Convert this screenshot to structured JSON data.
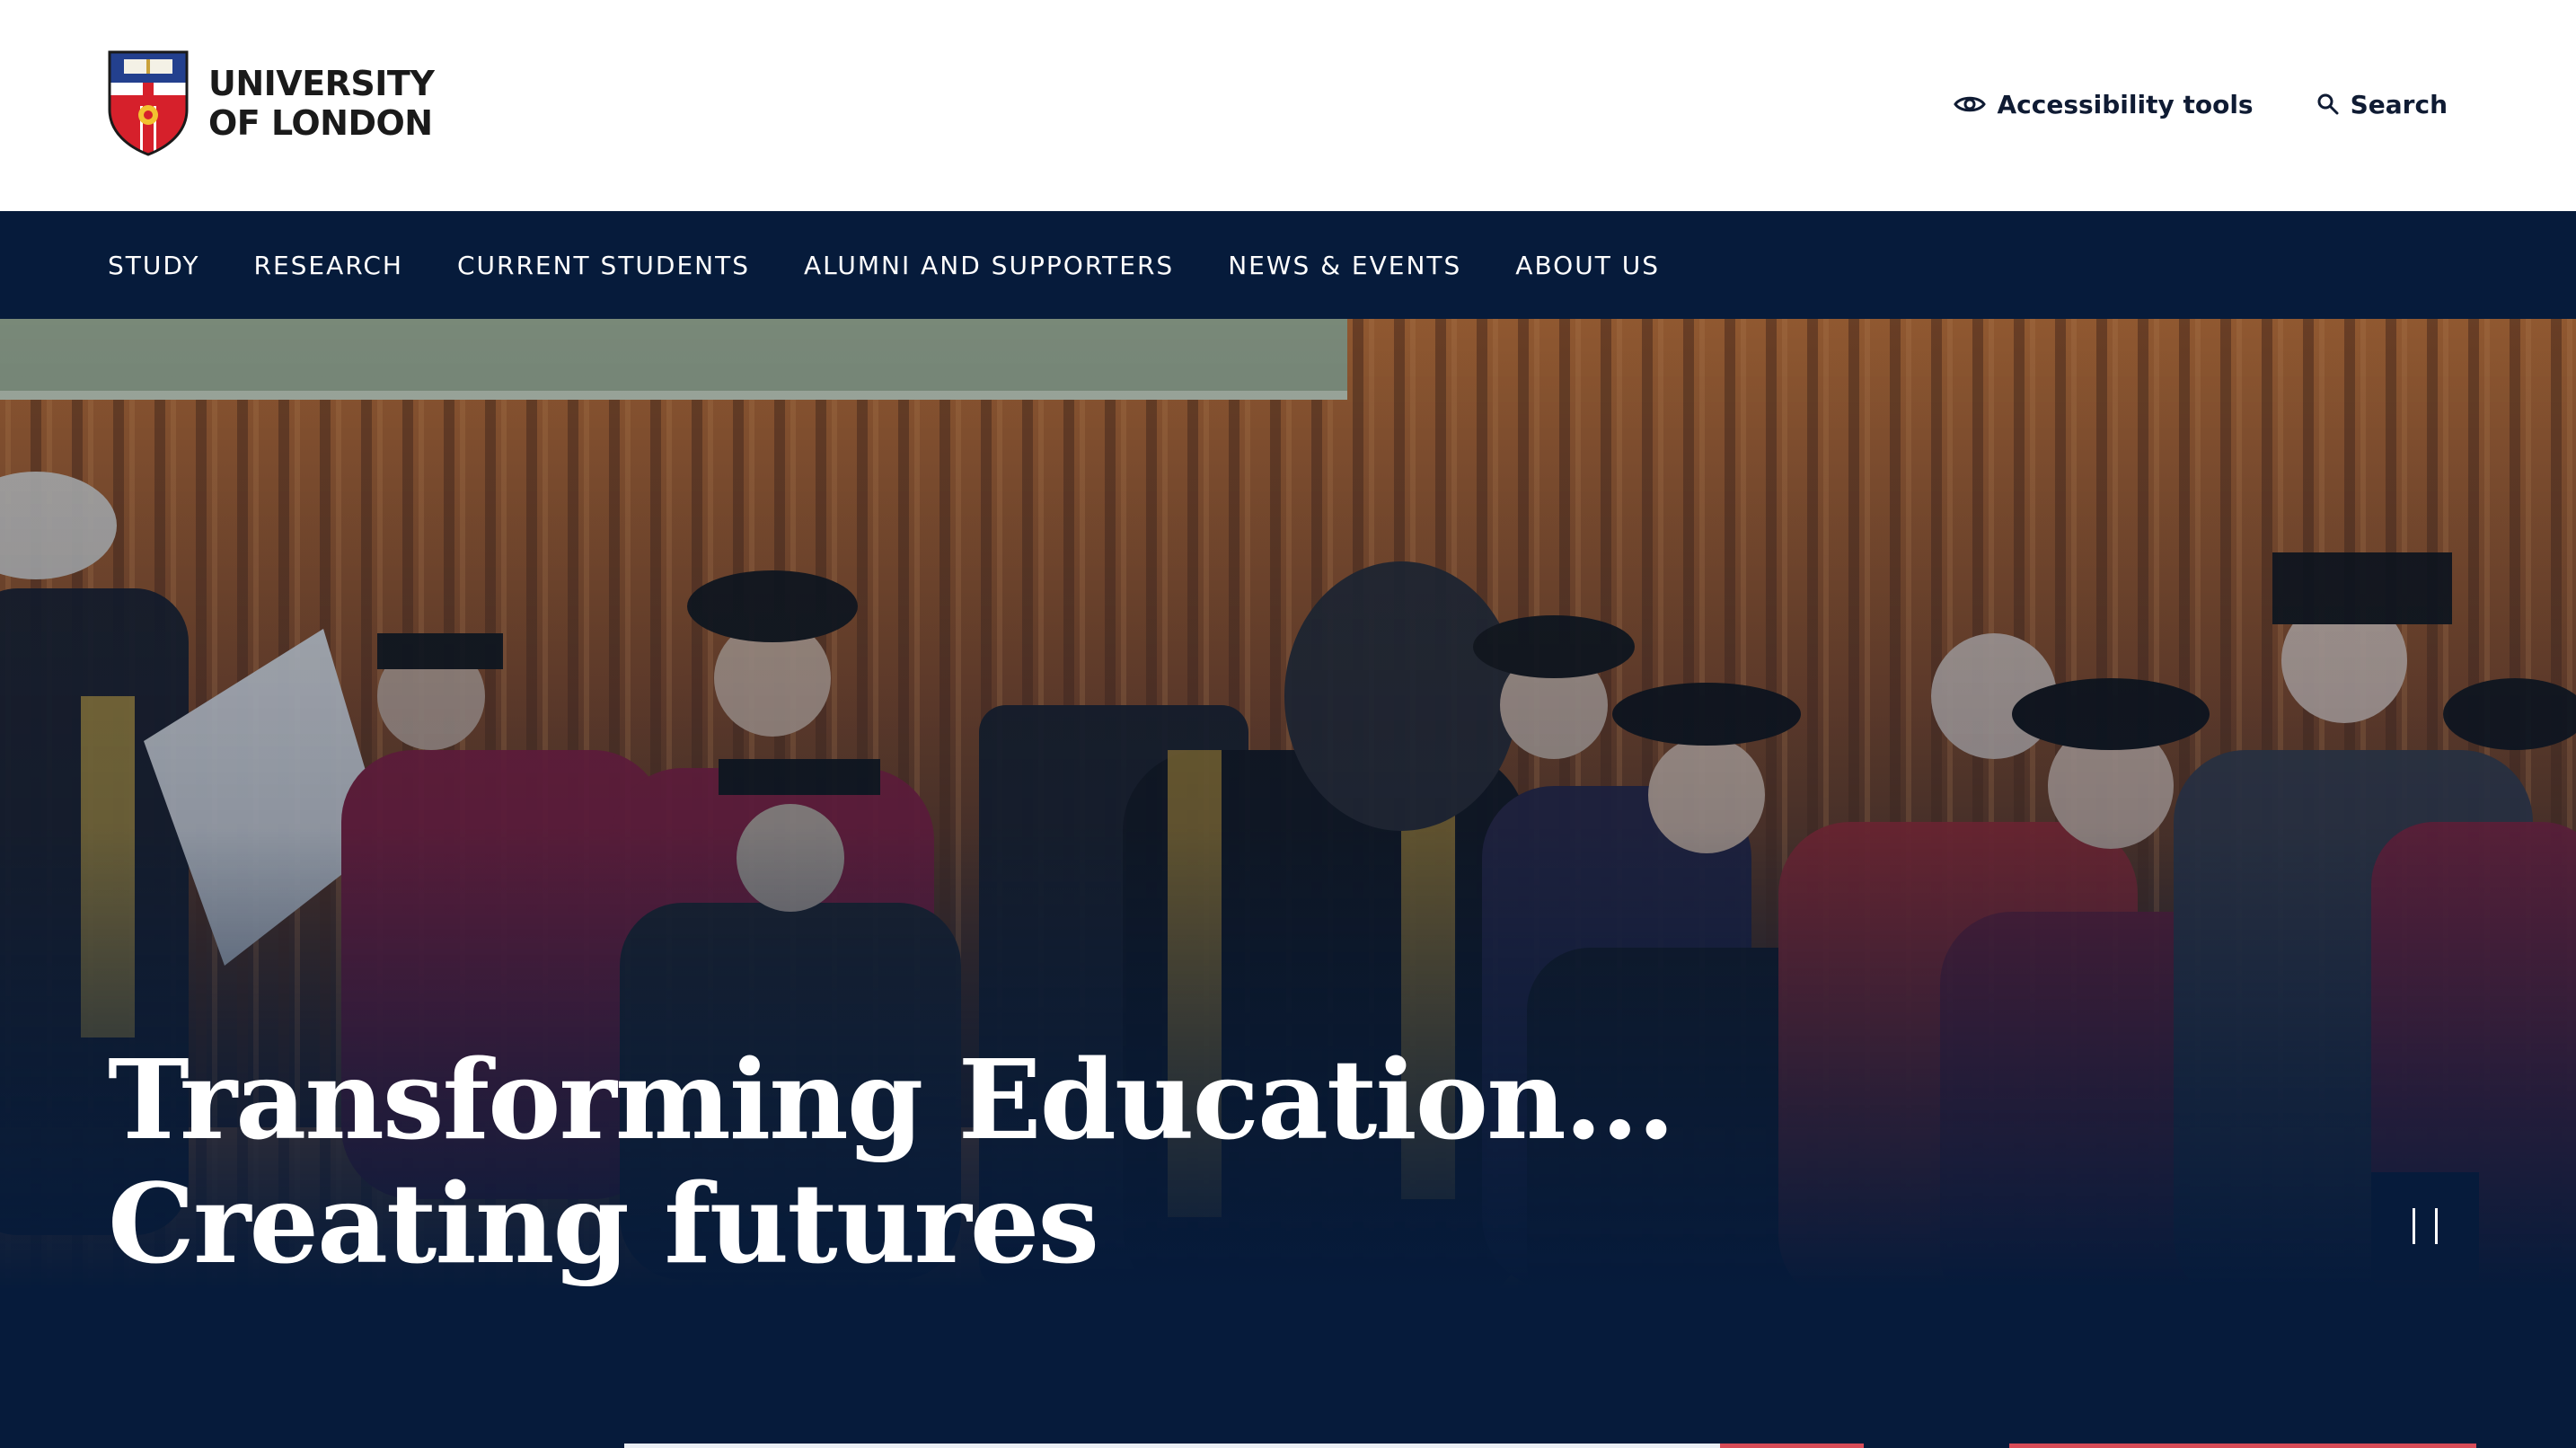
{
  "header": {
    "logo": {
      "line1": "UNIVERSITY",
      "line2": "OF LONDON"
    },
    "utility": {
      "accessibility_label": "Accessibility tools",
      "search_label": "Search"
    }
  },
  "nav": {
    "items": [
      {
        "label": "STUDY"
      },
      {
        "label": "RESEARCH"
      },
      {
        "label": "CURRENT STUDENTS"
      },
      {
        "label": "ALUMNI AND SUPPORTERS"
      },
      {
        "label": "NEWS & EVENTS"
      },
      {
        "label": "ABOUT US"
      }
    ]
  },
  "hero": {
    "title_line1": "Transforming Education...",
    "title_line2": "Creating futures"
  },
  "icons": {
    "accessibility": "eye-icon",
    "search": "search-icon",
    "pause": "pause-icon"
  },
  "colors": {
    "navy": "#061b3b",
    "white": "#ffffff",
    "accent_red": "#d74b57",
    "text_dark": "#0f1b33"
  }
}
